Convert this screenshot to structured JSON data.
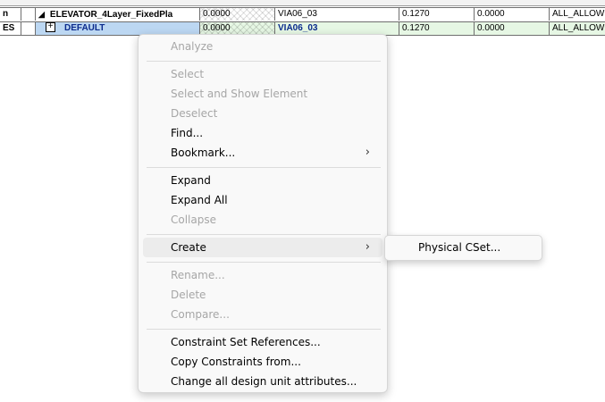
{
  "grid": {
    "row1": {
      "name_col": "n",
      "name": "ELEVATOR_4Layer_FixedPla",
      "val1": "0.0000",
      "via": "VIA06_03",
      "val2": "0.1270",
      "val3": "0.0000",
      "allow": "ALL_ALLOW"
    },
    "row2": {
      "name_col": "ES",
      "name": "DEFAULT",
      "val1": "0.0000",
      "via": "VIA06_03",
      "val2": "0.1270",
      "val3": "0.0000",
      "allow": "ALL_ALLOW"
    }
  },
  "menu": {
    "analyze": "Analyze",
    "select": "Select",
    "select_show": "Select and Show Element",
    "deselect": "Deselect",
    "find": "Find...",
    "bookmark": "Bookmark...",
    "expand": "Expand",
    "expand_all": "Expand All",
    "collapse": "Collapse",
    "create": "Create",
    "rename": "Rename...",
    "delete": "Delete",
    "compare": "Compare...",
    "cset_refs": "Constraint Set References...",
    "copy_constraints": "Copy Constraints from...",
    "change_units": "Change all design unit attributes...",
    "chevron": "›"
  },
  "submenu": {
    "physical_cset": "Physical CSet..."
  },
  "icons": {
    "expand_triangle": "◢",
    "plus": "+"
  }
}
